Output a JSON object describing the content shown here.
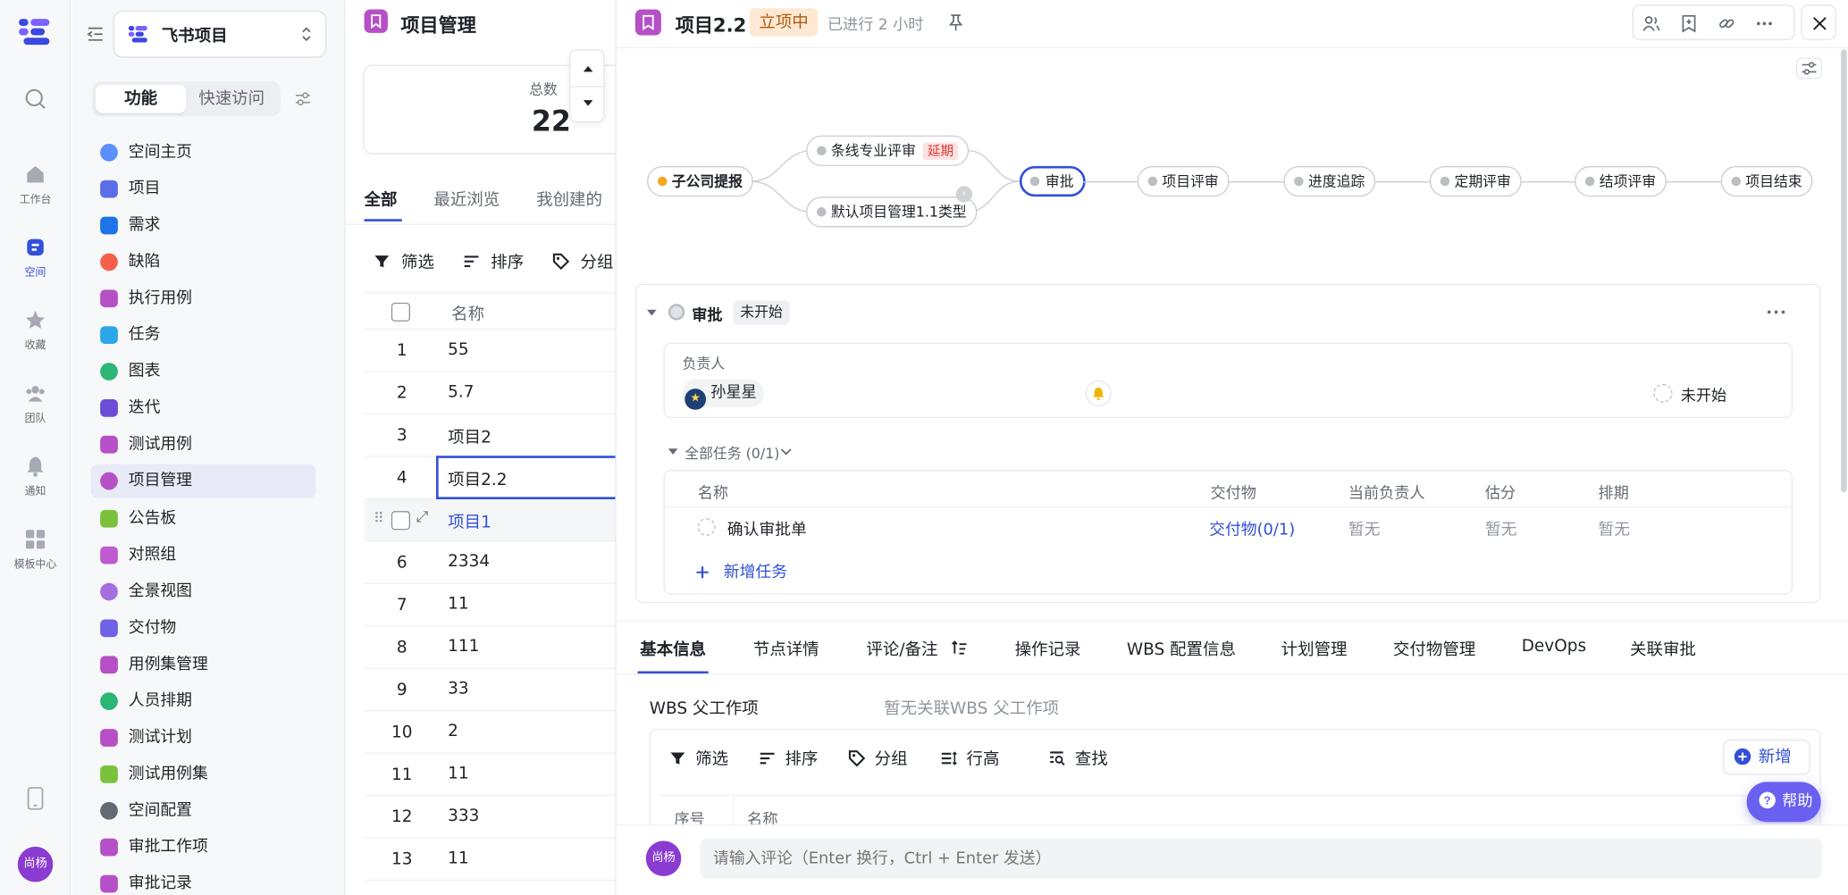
{
  "rail": {
    "items": [
      {
        "label": "工作台",
        "icon": "home-icon"
      },
      {
        "label": "空间",
        "icon": "space-icon"
      },
      {
        "label": "收藏",
        "icon": "star-icon"
      },
      {
        "label": "团队",
        "icon": "team-icon"
      },
      {
        "label": "通知",
        "icon": "bell-icon"
      },
      {
        "label": "模板中心",
        "icon": "template-icon"
      }
    ],
    "user_avatar": "尚杨"
  },
  "sidebar": {
    "space_name": "飞书项目",
    "segments": [
      "功能",
      "快速访问"
    ],
    "items": [
      {
        "label": "空间主页",
        "color": "#5b8ff9"
      },
      {
        "label": "项目",
        "color": "#5b6ee8"
      },
      {
        "label": "需求",
        "color": "#1c74e8"
      },
      {
        "label": "缺陷",
        "color": "#f5604d"
      },
      {
        "label": "执行用例",
        "color": "#b650c7"
      },
      {
        "label": "任务",
        "color": "#2ea7e8"
      },
      {
        "label": "图表",
        "color": "#2bb673"
      },
      {
        "label": "迭代",
        "color": "#6b4cd6"
      },
      {
        "label": "测试用例",
        "color": "#b650c7"
      },
      {
        "label": "项目管理",
        "color": "#b650c7"
      },
      {
        "label": "公告板",
        "color": "#7cc13b"
      },
      {
        "label": "对照组",
        "color": "#c05ad1"
      },
      {
        "label": "全景视图",
        "color": "#a66fe0"
      },
      {
        "label": "交付物",
        "color": "#6e62e5"
      },
      {
        "label": "用例集管理",
        "color": "#b650c7"
      },
      {
        "label": "人员排期",
        "color": "#2bb673"
      },
      {
        "label": "测试计划",
        "color": "#b650c7"
      },
      {
        "label": "测试用例集",
        "color": "#7cc13b"
      },
      {
        "label": "空间配置",
        "color": "#646a73"
      },
      {
        "label": "审批工作项",
        "color": "#b650c7"
      },
      {
        "label": "审批记录",
        "color": "#b650c7"
      }
    ]
  },
  "list": {
    "title": "项目管理",
    "total_label": "总数",
    "total_value": "22",
    "tabs": [
      "全部",
      "最近浏览",
      "我创建的"
    ],
    "tools": [
      "筛选",
      "排序",
      "分组"
    ],
    "column_name": "名称",
    "rows": [
      {
        "no": "1",
        "name": "55"
      },
      {
        "no": "2",
        "name": "5.7"
      },
      {
        "no": "3",
        "name": "项目2"
      },
      {
        "no": "4",
        "name": "项目2.2"
      },
      {
        "no": "",
        "name": "项目1"
      },
      {
        "no": "6",
        "name": "2334"
      },
      {
        "no": "7",
        "name": "11"
      },
      {
        "no": "8",
        "name": "111"
      },
      {
        "no": "9",
        "name": "33"
      },
      {
        "no": "10",
        "name": "2"
      },
      {
        "no": "11",
        "name": "11"
      },
      {
        "no": "12",
        "name": "333"
      },
      {
        "no": "13",
        "name": "11"
      }
    ]
  },
  "detail": {
    "title": "项目2.2",
    "status": "立项中",
    "elapsed": "已进行 2 小时",
    "flow": {
      "start": "子公司提报",
      "branch_top": "条线专业评审",
      "branch_top_tag": "延期",
      "branch_bottom": "默认项目管理1.1类型",
      "nodes": [
        "审批",
        "项目评审",
        "进度追踪",
        "定期评审",
        "结项评审",
        "项目结束"
      ]
    },
    "node_section": {
      "name": "审批",
      "status": "未开始",
      "owner_label": "负责人",
      "owner": "孙星星",
      "node_state": "未开始",
      "tasks_label": "全部任务 (0/1)",
      "columns": [
        "名称",
        "交付物",
        "当前负责人",
        "估分",
        "排期"
      ],
      "task": {
        "name": "确认审批单",
        "deliverable": "交付物(0/1)",
        "owner": "暂无",
        "score": "暂无",
        "schedule": "暂无"
      },
      "add_task": "新增任务"
    },
    "tabs": [
      "基本信息",
      "节点详情",
      "评论/备注",
      "操作记录",
      "WBS 配置信息",
      "计划管理",
      "交付物管理",
      "DevOps",
      "关联审批"
    ],
    "wbs_label": "WBS 父工作项",
    "wbs_empty": "暂无关联WBS 父工作项",
    "wbs_tools": [
      "筛选",
      "排序",
      "分组",
      "行高",
      "查找"
    ],
    "wbs_add": "新增",
    "wbs_columns": [
      "序号",
      "名称"
    ],
    "help": "帮助",
    "comment_avatar": "尚杨",
    "comment_placeholder": "请输入评论（Enter 换行，Ctrl + Enter 发送）"
  }
}
